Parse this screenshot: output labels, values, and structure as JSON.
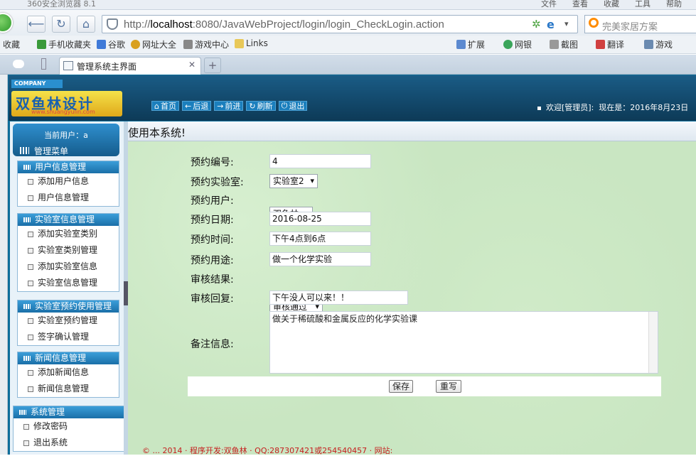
{
  "browser": {
    "app_name": "360安全浏览器 8.1",
    "menus": [
      "文件",
      "查看",
      "收藏",
      "工具",
      "帮助"
    ],
    "url_prefix": "http://",
    "url_host": "localhost",
    "url_rest": ":8080/JavaWebProject/login/login_CheckLogin.action",
    "search_placeholder": "完美家居方案",
    "tab_title": "管理系统主界面",
    "favorites": [
      "收藏",
      "手机收藏夹",
      "谷歌",
      "网址大全",
      "游戏中心",
      "Links"
    ],
    "tools": [
      "扩展",
      "网银",
      "截图",
      "翻译",
      "游戏"
    ]
  },
  "header": {
    "company": "COMPANY",
    "brand": "双鱼林设计",
    "brand_url": "www.shuangyulin.com",
    "nav": [
      "首页",
      "后退",
      "前进",
      "刷新",
      "退出"
    ],
    "welcome": "欢迎[管理员]:",
    "now": "现在是：2016年8月23日"
  },
  "sidebar": {
    "current_user": "当前用户：a",
    "menu_title": "管理菜单",
    "groups": [
      {
        "title": "用户信息管理",
        "items": [
          "添加用户信息",
          "用户信息管理"
        ]
      },
      {
        "title": "实验室信息管理",
        "items": [
          "添加实验室类别",
          "实验室类别管理",
          "添加实验室信息",
          "实验室信息管理"
        ]
      },
      {
        "title": "实验室预约使用管理",
        "items": [
          "实验室预约管理",
          "签字确认管理"
        ]
      },
      {
        "title": "新闻信息管理",
        "items": [
          "添加新闻信息",
          "新闻信息管理"
        ]
      },
      {
        "title": "系统管理",
        "items": [
          "修改密码",
          "退出系统"
        ]
      }
    ]
  },
  "main": {
    "welcome_text": "使用本系统!",
    "form": {
      "labels": [
        "预约编号:",
        "预约实验室:",
        "预约用户:",
        "预约日期:",
        "预约时间:",
        "预约用途:",
        "审核结果:",
        "审核回复:",
        "备注信息:"
      ],
      "booking_id": "4",
      "lab": "实验室2",
      "user": "双鱼林",
      "date": "2016-08-25",
      "time": "下午4点到6点",
      "purpose": "做一个化学实验",
      "result": "审核通过",
      "reply": "下午没人可以来！！",
      "notes": "做关于稀硫酸和金属反应的化学实验课"
    },
    "save_label": "保存",
    "reset_label": "重写"
  },
  "footer": {
    "text": "© ... 2014 · 程序开发:双鱼林 · QQ:287307421或254540457 · 网站:"
  }
}
